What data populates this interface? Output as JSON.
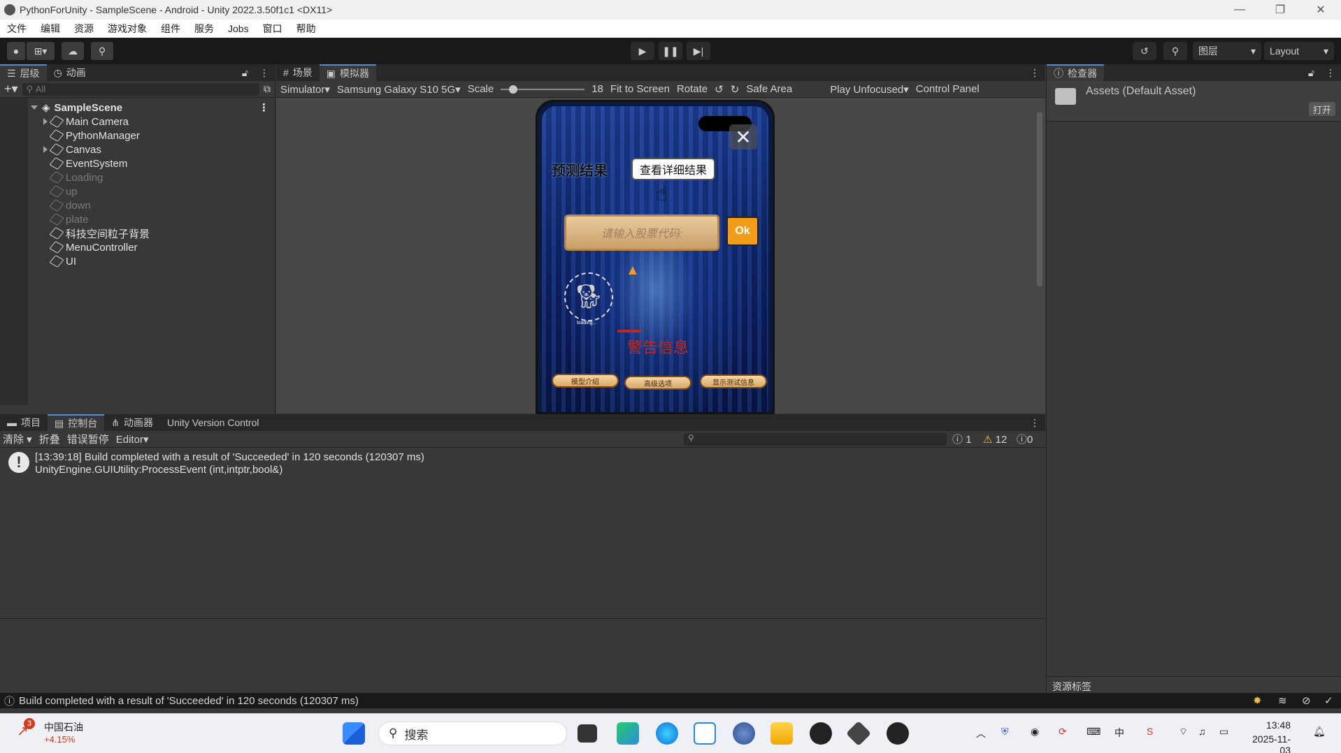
{
  "window": {
    "title": "PythonForUnity - SampleScene - Android - Unity 2022.3.50f1c1 <DX11>",
    "controls": [
      "—",
      "❐",
      "✕"
    ]
  },
  "menubar": [
    "文件",
    "编辑",
    "资源",
    "游戏对象",
    "组件",
    "服务",
    "Jobs",
    "窗口",
    "帮助"
  ],
  "toolbar": {
    "layers_label": "图层",
    "layout_label": "Layout"
  },
  "hierarchy": {
    "tabs": [
      {
        "label": "层级",
        "icon": "list-icon"
      },
      {
        "label": "动画",
        "icon": "clock-icon"
      }
    ],
    "search_placeholder": "All",
    "scene": "SampleScene",
    "items": [
      {
        "label": "Main Camera",
        "expandable": true,
        "active": true
      },
      {
        "label": "PythonManager",
        "expandable": false,
        "active": true
      },
      {
        "label": "Canvas",
        "expandable": true,
        "active": true
      },
      {
        "label": "EventSystem",
        "expandable": false,
        "active": true
      },
      {
        "label": "Loading",
        "expandable": false,
        "active": false
      },
      {
        "label": "up",
        "expandable": false,
        "active": false
      },
      {
        "label": "down",
        "expandable": false,
        "active": false
      },
      {
        "label": "plate",
        "expandable": false,
        "active": false
      },
      {
        "label": "科技空间粒子背景",
        "expandable": false,
        "active": true
      },
      {
        "label": "MenuController",
        "expandable": false,
        "active": true
      },
      {
        "label": "UI",
        "expandable": false,
        "active": true
      }
    ]
  },
  "scene_view": {
    "tabs": [
      {
        "label": "场景",
        "icon": "grid-icon"
      },
      {
        "label": "模拟器",
        "icon": "device-icon"
      }
    ],
    "simulator_label": "Simulator",
    "device": "Samsung Galaxy S10 5G",
    "scale_label": "Scale",
    "scale_value": "18",
    "fit_label": "Fit to Screen",
    "rotate_label": "Rotate",
    "safe_area_label": "Safe Area",
    "play_mode": "Play Unfocused",
    "control_panel": "Control Panel",
    "game": {
      "title": "预测结果",
      "detail_button": "查看详细结果",
      "input_placeholder": "请输入股票代码:",
      "ok_button": "Ok",
      "loading_caption": "loading...",
      "warning": "警告信息",
      "buttons": [
        "模型介绍",
        "高级选项",
        "显示测试信息"
      ]
    }
  },
  "inspector": {
    "tab": "检查器",
    "asset": "Assets (Default Asset)",
    "open_button": "打开",
    "asset_labels": "资源标签"
  },
  "console": {
    "tabs": [
      {
        "label": "项目",
        "icon": "folder-icon"
      },
      {
        "label": "控制台",
        "icon": "console-icon"
      },
      {
        "label": "动画器",
        "icon": "animator-icon"
      },
      {
        "label": "Unity Version Control",
        "icon": ""
      }
    ],
    "clear": "清除",
    "collapse": "折叠",
    "error_pause": "错误暂停",
    "editor": "Editor",
    "counts": {
      "info": "1",
      "warn": "12",
      "error": "0"
    },
    "entry_line1": "[13:39:18] Build completed with a result of 'Succeeded' in 120 seconds (120307 ms)",
    "entry_line2": "UnityEngine.GUIUtility:ProcessEvent (int,intptr,bool&)"
  },
  "statusbar": {
    "message": "Build completed with a result of 'Succeeded' in 120 seconds (120307 ms)"
  },
  "taskbar": {
    "stock_name": "中国石油",
    "stock_change": "+4.15%",
    "badge": "3",
    "search": "搜索",
    "time": "13:48",
    "date": "2025-11-03"
  },
  "colors": {
    "accent": "#4b8dd8",
    "warning": "#f0c040",
    "game_warning": "#c0281e"
  }
}
